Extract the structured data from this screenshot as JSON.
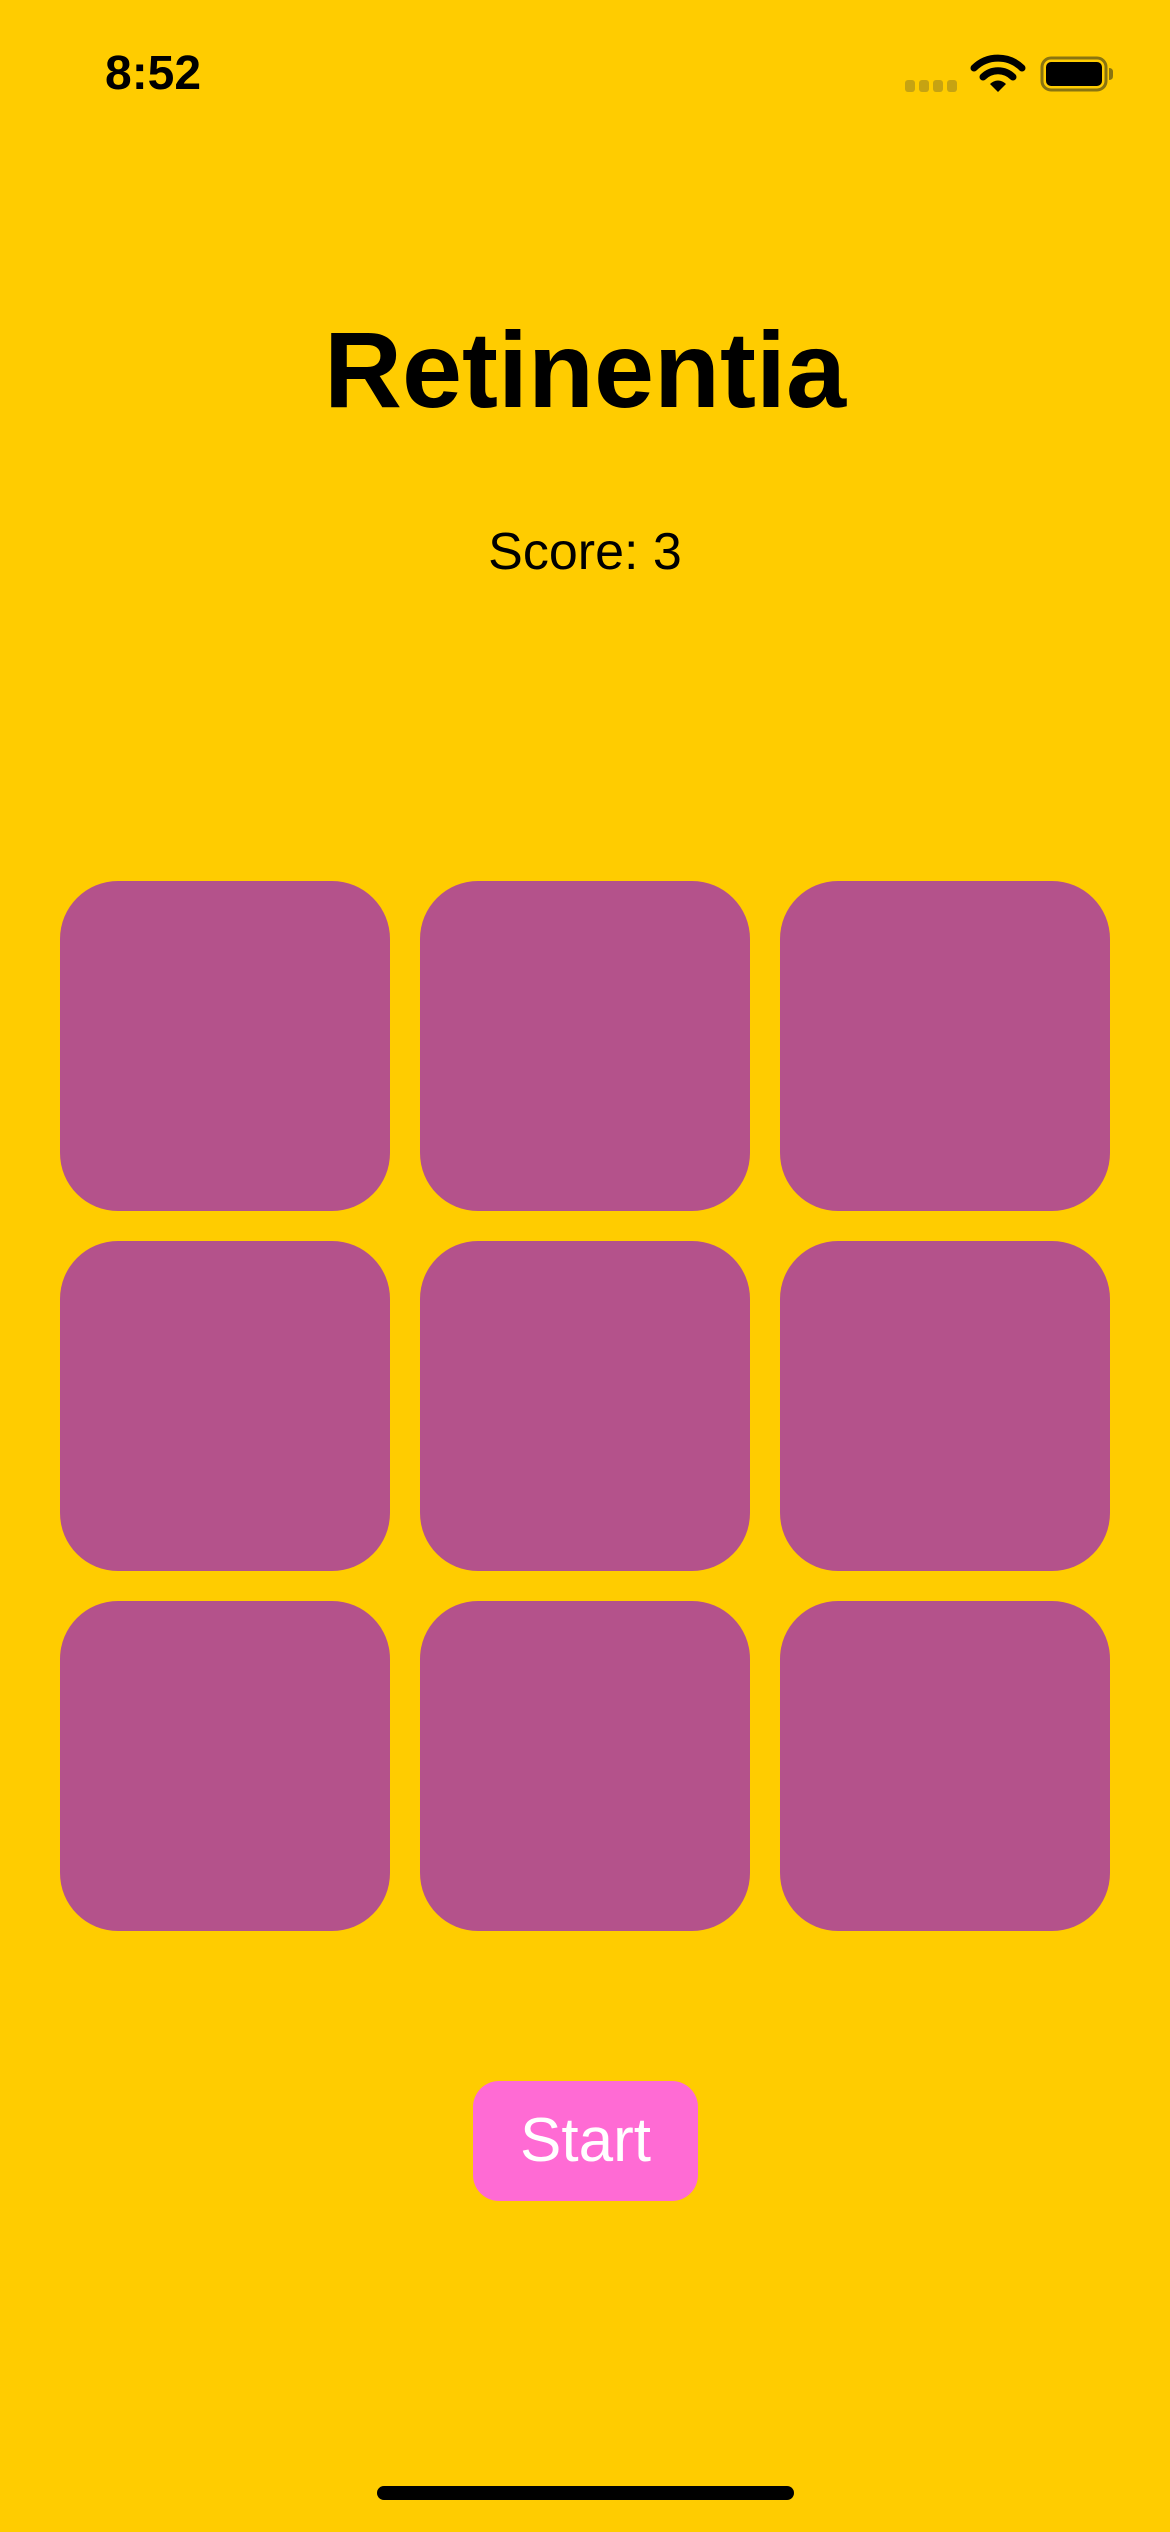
{
  "status_bar": {
    "time": "8:52",
    "icons": [
      "cellular-signal-icon",
      "wifi-icon",
      "battery-icon"
    ]
  },
  "app": {
    "title": "Retinentia",
    "score_text": "Score: 3",
    "start_label": "Start"
  },
  "grid": {
    "rows": 3,
    "columns": 3,
    "tiles": [
      {
        "state": "idle"
      },
      {
        "state": "idle"
      },
      {
        "state": "idle"
      },
      {
        "state": "idle"
      },
      {
        "state": "idle"
      },
      {
        "state": "idle"
      },
      {
        "state": "idle"
      },
      {
        "state": "idle"
      },
      {
        "state": "idle"
      }
    ]
  },
  "colors": {
    "background": "#FFCC00",
    "tile": "#B4528B",
    "start_button": "#FF6BD4",
    "text": "#000000",
    "start_text": "#FFFFFF"
  }
}
